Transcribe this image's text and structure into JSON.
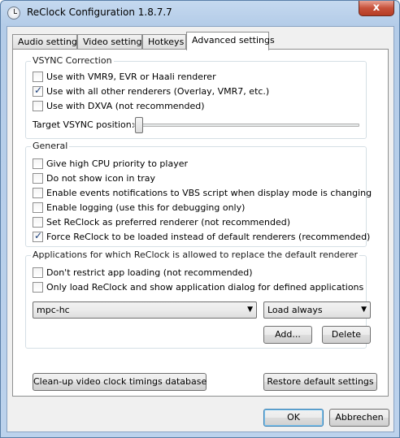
{
  "window": {
    "title": "ReClock Configuration 1.8.7.7",
    "close_label": "x"
  },
  "tabs": [
    {
      "label": "Audio settings",
      "active": false
    },
    {
      "label": "Video settings",
      "active": false
    },
    {
      "label": "Hotkeys",
      "active": false
    },
    {
      "label": "Advanced settings",
      "active": true
    }
  ],
  "vsync": {
    "legend": "VSYNC Correction",
    "options": [
      {
        "label": "Use with VMR9, EVR or Haali renderer",
        "checked": false
      },
      {
        "label": "Use with all other renderers (Overlay, VMR7, etc.)",
        "checked": true
      },
      {
        "label": "Use with DXVA (not recommended)",
        "checked": false
      }
    ],
    "slider_label": "Target VSYNC position:",
    "slider_value": 0
  },
  "general": {
    "legend": "General",
    "options": [
      {
        "label": "Give high CPU priority to player",
        "checked": false
      },
      {
        "label": "Do not show icon in tray",
        "checked": false
      },
      {
        "label": "Enable events notifications to VBS script when display mode is changing",
        "checked": false
      },
      {
        "label": "Enable logging (use this for debugging only)",
        "checked": false
      },
      {
        "label": "Set ReClock as preferred renderer (not recommended)",
        "checked": false
      },
      {
        "label": "Force ReClock to be loaded instead of default renderers (recommended)",
        "checked": true
      }
    ]
  },
  "apps": {
    "legend": "Applications for which ReClock is allowed to replace the default renderer",
    "options": [
      {
        "label": "Don't restrict app loading (not recommended)",
        "checked": false
      },
      {
        "label": "Only load ReClock and show application dialog for defined applications",
        "checked": false
      }
    ],
    "app_select": "mpc-hc",
    "mode_select": "Load always",
    "add_label": "Add...",
    "delete_label": "Delete"
  },
  "bottom": {
    "cleanup_label": "Clean-up video clock timings database",
    "restore_label": "Restore default settings"
  },
  "footer": {
    "ok_label": "OK",
    "cancel_label": "Abbrechen"
  }
}
